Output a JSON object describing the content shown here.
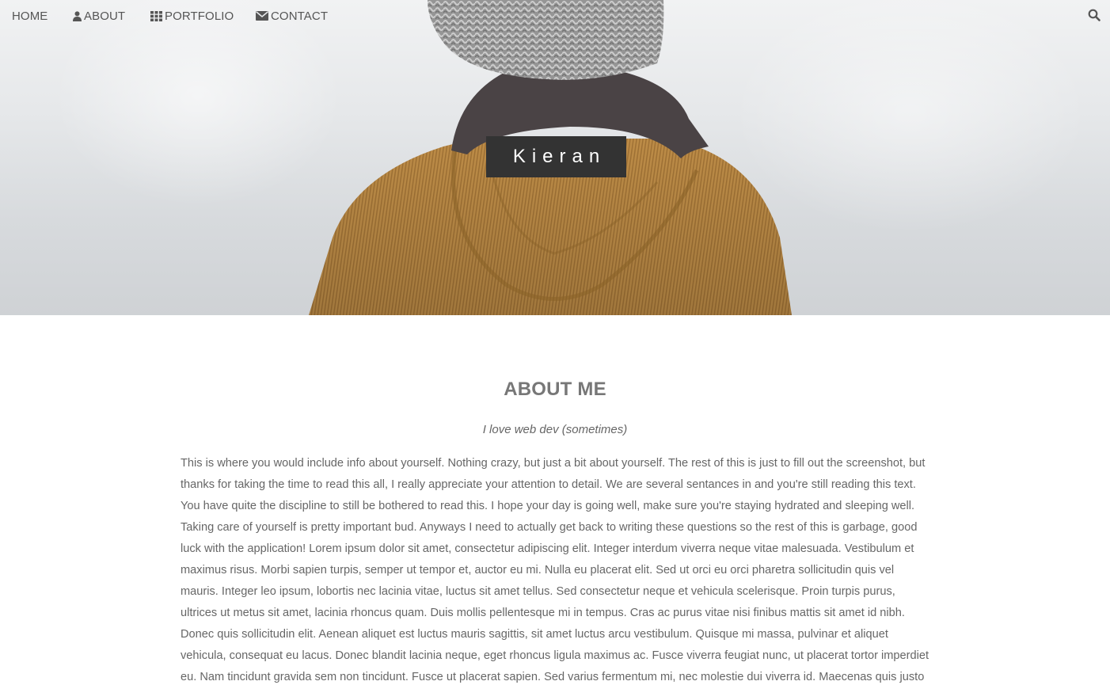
{
  "nav": {
    "items": [
      {
        "label": "HOME",
        "icon": ""
      },
      {
        "label": "ABOUT",
        "icon": "user-icon"
      },
      {
        "label": "PORTFOLIO",
        "icon": "grid-icon"
      },
      {
        "label": "CONTACT",
        "icon": "envelope-icon"
      }
    ],
    "search_icon": "search-icon",
    "text_color": "#555555"
  },
  "hero": {
    "title": "Kieran",
    "badge_color": "#333333",
    "jacket_color": "#b98a45"
  },
  "about": {
    "heading": "ABOUT ME",
    "subtitle": "I love web dev (sometimes)",
    "body": "This is where you would include info about yourself. Nothing crazy, but just a bit about yourself. The rest of this is just to fill out the screenshot, but thanks for taking the time to read this all, I really appreciate your attention to detail. We are several sentances in and you're still reading this text. You have quite the discipline to still be bothered to read this. I hope your day is going well, make sure you're staying hydrated and sleeping well. Taking care of yourself is pretty important bud. Anyways I need to actually get back to writing these questions so the rest of this is garbage, good luck with the application! Lorem ipsum dolor sit amet, consectetur adipiscing elit. Integer interdum viverra neque vitae malesuada. Vestibulum et maximus risus. Morbi sapien turpis, semper ut tempor et, auctor eu mi. Nulla eu placerat elit. Sed ut orci eu orci pharetra sollicitudin quis vel mauris. Integer leo ipsum, lobortis nec lacinia vitae, luctus sit amet tellus. Sed consectetur neque et vehicula scelerisque. Proin turpis purus, ultrices ut metus sit amet, lacinia rhoncus quam. Duis mollis pellentesque mi in tempus. Cras ac purus vitae nisi finibus mattis sit amet id nibh. Donec quis sollicitudin elit. Aenean aliquet est luctus mauris sagittis, sit amet luctus arcu vestibulum. Quisque mi massa, pulvinar et aliquet vehicula, consequat eu lacus. Donec blandit lacinia neque, eget rhoncus ligula maximus ac. Fusce viverra feugiat nunc, ut placerat tortor imperdiet eu. Nam tincidunt gravida sem non tincidunt. Fusce ut placerat sapien. Sed varius fermentum mi, nec molestie dui viverra id. Maecenas quis justo"
  }
}
